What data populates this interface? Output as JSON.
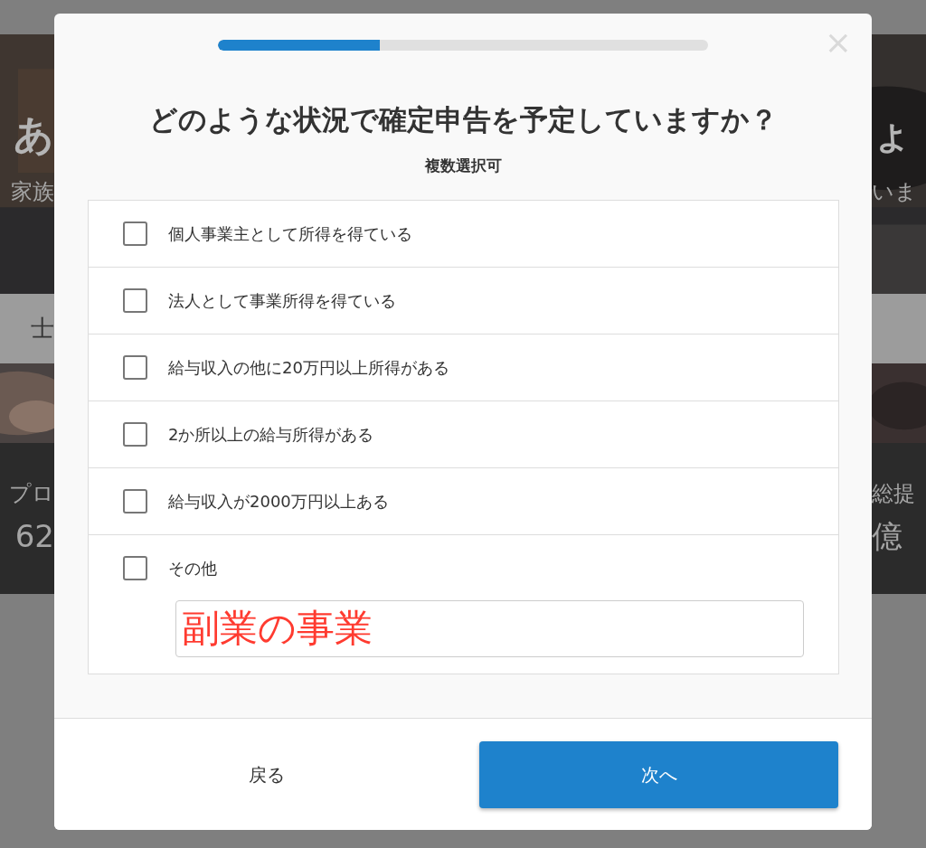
{
  "background": {
    "left_texts": [
      {
        "kind": "headline",
        "text": "あ"
      },
      {
        "kind": "sub",
        "text": "家族"
      },
      {
        "kind": "band",
        "text": "士"
      },
      {
        "kind": "stat_label",
        "text": "プロ"
      },
      {
        "kind": "stat_value",
        "text": "62"
      }
    ],
    "right_texts": [
      {
        "kind": "headline",
        "text": "ょ"
      },
      {
        "kind": "sub",
        "text": "いま"
      },
      {
        "kind": "stat_label",
        "text": "総提"
      },
      {
        "kind": "stat_value",
        "text": "億"
      }
    ]
  },
  "dialog": {
    "progress": {
      "level": 0.33
    },
    "close": "×",
    "title": "どのような状況で確定申告を予定していますか？",
    "subtitle": "複数選択可",
    "options": [
      {
        "label": "個人事業主として所得を得ている",
        "checked": false
      },
      {
        "label": "法人として事業所得を得ている",
        "checked": false
      },
      {
        "label": "給与収入の他に20万円以上所得がある",
        "checked": false
      },
      {
        "label": "2か所以上の給与所得がある",
        "checked": false
      },
      {
        "label": "給与収入が2000万円以上ある",
        "checked": false
      },
      {
        "label": "その他",
        "checked": false,
        "input": {
          "value": "副業の事業"
        }
      }
    ],
    "back_button": "戻る",
    "next_button": "次へ"
  }
}
